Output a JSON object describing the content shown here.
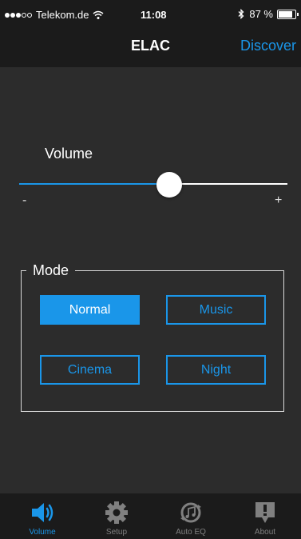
{
  "status_bar": {
    "carrier": "Telekom.de",
    "time": "11:08",
    "battery": "87 %",
    "battery_level": 0.87
  },
  "nav": {
    "title": "ELAC",
    "discover_label": "Discover"
  },
  "volume": {
    "label": "Volume",
    "min_label": "-",
    "max_label": "+",
    "level": 0.56
  },
  "mode": {
    "legend": "Mode",
    "buttons": [
      {
        "label": "Normal",
        "active": true
      },
      {
        "label": "Music",
        "active": false
      },
      {
        "label": "Cinema",
        "active": false
      },
      {
        "label": "Night",
        "active": false
      }
    ]
  },
  "tabs": [
    {
      "label": "Volume",
      "icon": "speaker-icon",
      "active": true
    },
    {
      "label": "Setup",
      "icon": "gear-icon",
      "active": false
    },
    {
      "label": "Auto EQ",
      "icon": "auto-eq-icon",
      "active": false
    },
    {
      "label": "About",
      "icon": "about-icon",
      "active": false
    }
  ],
  "colors": {
    "accent": "#1a96e9",
    "background": "#2c2c2c",
    "bar": "#1b1b1b"
  }
}
